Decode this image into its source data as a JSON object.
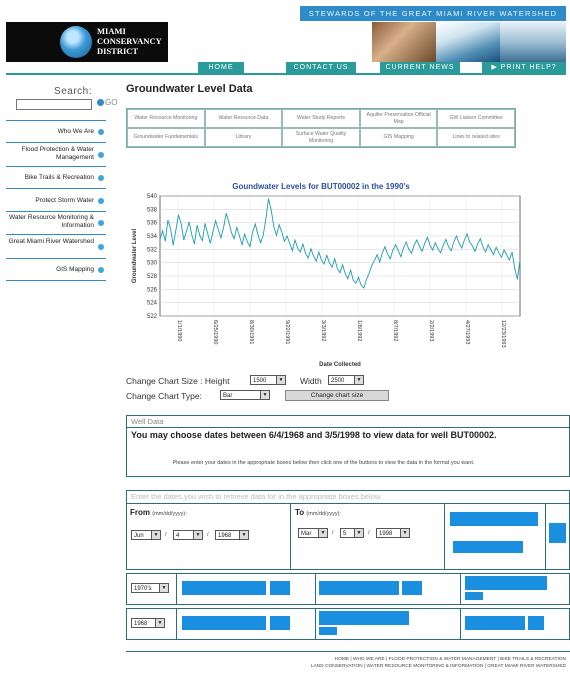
{
  "header": {
    "tagline": "STEWARDS OF THE GREAT MIAMI RIVER WATERSHED",
    "logo_lines": [
      "MIAMI",
      "CONSERVANCY",
      "DISTRICT"
    ],
    "nav": [
      "HOME",
      "CONTACT US",
      "CURRENT NEWS",
      "▶ PRINT HELP?"
    ]
  },
  "sidebar": {
    "search_label": "Search:",
    "go_label": "GO",
    "items": [
      "Who We Are",
      "Flood Protection & Water Management",
      "Bike Trails & Recreation",
      "Protect Storm Water",
      "Water Resource Monitoring & Information",
      "Great Miami River Watershed",
      "GIS Mapping"
    ]
  },
  "main": {
    "title": "Groundwater Level Data",
    "links": [
      "Water Resource Monitoring",
      "Water Resource Data",
      "Water Study Reports",
      "Aquifer Preservation Official Map",
      "GW Liaison Committee",
      "Groundwater Fundamentals",
      "Library",
      "Surface Water Quality Monitoring",
      "GIS Mapping",
      "Links to related sites"
    ]
  },
  "chart_data": {
    "type": "line",
    "title": "Goundwater Levels for BUT00002 in the 1990's",
    "xlabel": "Date Collected",
    "ylabel": "Groundwater Level",
    "ylim": [
      522,
      540
    ],
    "yticks": [
      540,
      538,
      536,
      534,
      532,
      530,
      528,
      526,
      524,
      522
    ],
    "xticks": [
      "1/1/1990",
      "6/25/1990",
      "8/30/1991",
      "9/22/1991",
      "3/3/1992",
      "1/8/1992",
      "8/7/1992",
      "2/2/1993",
      "4/27/1993",
      "12/23/1993"
    ],
    "series": [
      {
        "values": [
          533.5,
          534.8,
          533.2,
          536.4,
          535.1,
          532.6,
          534.9,
          537.2,
          535.8,
          533.4,
          534.7,
          536.1,
          534.2,
          532.8,
          535.6,
          534.1,
          533.3,
          535.9,
          534.4,
          532.9,
          534.6,
          536.3,
          535.0,
          533.7,
          535.2,
          537.4,
          536.1,
          534.5,
          533.6,
          535.3,
          534.0,
          532.7,
          534.3,
          533.1,
          532.4,
          534.6,
          535.8,
          534.2,
          533.0,
          534.1,
          536.6,
          539.6,
          537.9,
          535.4,
          534.1,
          535.7,
          534.6,
          533.2,
          534.0,
          532.9,
          531.8,
          533.4,
          532.2,
          531.6,
          532.8,
          531.4,
          530.7,
          532.1,
          531.0,
          530.2,
          531.6,
          530.4,
          529.8,
          531.1,
          530.0,
          529.3,
          530.6,
          529.1,
          528.5,
          529.7,
          528.3,
          527.6,
          528.9,
          527.4,
          526.9,
          527.8,
          526.6,
          526.2,
          527.5,
          528.4,
          529.6,
          530.3,
          531.2,
          530.1,
          531.5,
          532.4,
          531.3,
          530.6,
          531.9,
          532.7,
          531.8,
          530.9,
          532.2,
          533.1,
          532.0,
          531.4,
          532.6,
          533.4,
          532.5,
          531.7,
          532.9,
          533.8,
          532.6,
          531.9,
          533.0,
          532.1,
          531.5,
          532.6,
          533.5,
          532.4,
          531.8,
          533.1,
          534.0,
          532.9,
          532.2,
          533.4,
          534.3,
          533.1,
          532.5,
          531.7,
          532.8,
          533.6,
          532.4,
          531.6,
          532.7,
          531.9,
          531.2,
          532.3,
          531.5,
          530.8,
          531.9,
          531.1,
          530.4,
          531.6,
          529.2,
          527.5,
          530.4
        ]
      }
    ]
  },
  "chart_controls": {
    "size_label": "Change Chart Size : Height",
    "height_value": "1500",
    "width_label": "Width",
    "width_value": "2500",
    "type_label": "Change Chart Type:",
    "type_value": "Bar",
    "button": "Change chart size"
  },
  "well_data": {
    "heading": "Well Data",
    "message": "You may choose dates between 6/4/1968 and 3/5/1998 to view data for well BUT00002.",
    "instructions": "Please enter your dates in the appropriate boxes below then click one of the buttons to view the data in the format you want."
  },
  "date_form": {
    "heading": "Enter the dates you wish to retrieve data for in the appropriate boxes below.",
    "from_label": "From",
    "to_label": "To",
    "format_hint": "(mm/dd/yyyy):",
    "from": {
      "month": "Jun",
      "day": "4",
      "year": "1968"
    },
    "to": {
      "month": "Mar",
      "day": "5",
      "year": "1998"
    },
    "decade_value": "1970's",
    "year_value": "1968"
  },
  "footer": {
    "line1": "HOME | WHO WE ARE | FLOOD PROTECTION & WATER MANAGEMENT | BIKE TRAILS & RECREATION",
    "line2": "LAND CONSERVATION | WATER RESOURCE MONITORING & INFORMATION | GREAT MIAMI RIVER WATERSHED"
  },
  "colors": {
    "brand_blue": "#2e8bc8",
    "nav_teal": "#2a9a9a",
    "chart_line": "#1f9bb0",
    "action_blue": "#1a8fe0"
  }
}
